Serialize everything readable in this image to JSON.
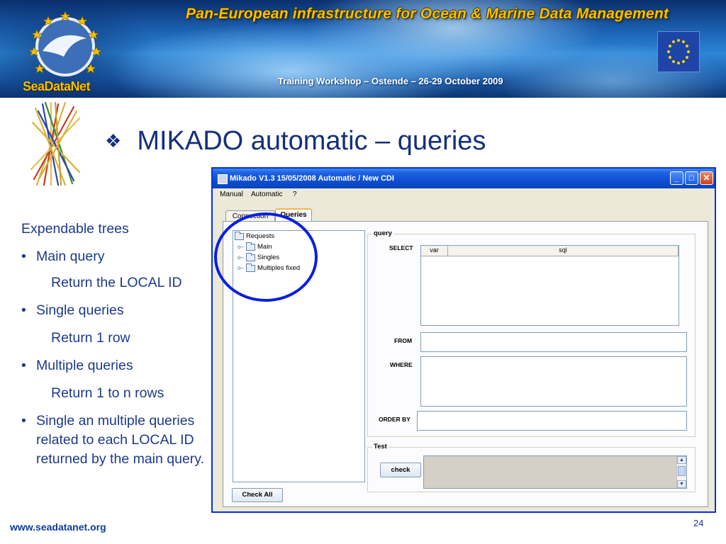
{
  "banner": {
    "title": "Pan-European infrastructure for Ocean & Marine Data Management",
    "subtitle": "Training Workshop – Ostende – 26-29 October 2009",
    "logo_text": "SeaDataNet"
  },
  "slide": {
    "title": "MIKADO automatic – queries",
    "title_bullet": "❖",
    "intro": "Expendable trees",
    "bullets": [
      {
        "text": "Main query",
        "sub": "Return the LOCAL ID"
      },
      {
        "text": "Single queries",
        "sub": "Return 1 row"
      },
      {
        "text": "Multiple queries",
        "sub": "Return 1 to n rows"
      },
      {
        "text": "Single an multiple queries related to each LOCAL ID returned by the main query."
      }
    ],
    "footer_url": "www.seadatanet.org",
    "page_number": "24"
  },
  "app": {
    "window_title": "Mikado V1.3 15/05/2008      Automatic / New CDI",
    "controls": {
      "minimize": "_",
      "maximize": "□",
      "close": "✕"
    },
    "menu": [
      "Manual",
      "Automatic",
      "?"
    ],
    "tabs": [
      {
        "label": "Connection",
        "selected": false
      },
      {
        "label": "Queries",
        "selected": true
      }
    ],
    "tree": {
      "root": "Requests",
      "children": [
        "Main",
        "Singles",
        "Multiples fixed"
      ],
      "expander": "o–"
    },
    "check_all_label": "Check All",
    "query_group": {
      "label": "query",
      "select_label": "SELECT",
      "columns": [
        "var",
        "sql"
      ],
      "from_label": "FROM",
      "where_label": "WHERE",
      "order_by_label": "ORDER BY",
      "from_value": "",
      "where_value": "",
      "order_by_value": ""
    },
    "test_group": {
      "label": "Test",
      "check_label": "check",
      "scroll_up": "▲",
      "scroll_down": "▼"
    }
  },
  "colors": {
    "slide_text": "#1d3a8a",
    "banner_title": "#f2c200",
    "highlight_circle": "#0a1fe0",
    "window_border": "#0831d9"
  }
}
